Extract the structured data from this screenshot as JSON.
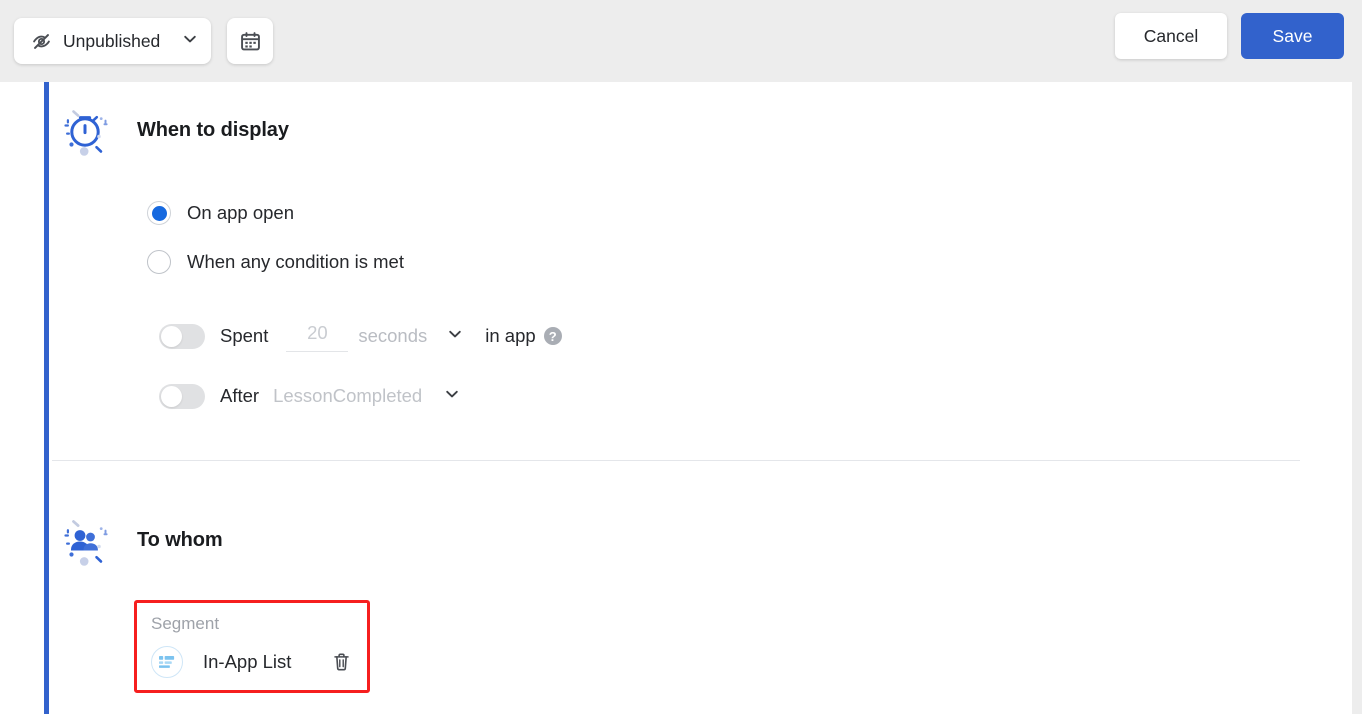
{
  "topbar": {
    "status": {
      "icon": "eye-off-icon",
      "label": "Unpublished",
      "chevron": "chevron-down-icon"
    },
    "schedule_button_icon": "calendar-icon",
    "cancel_label": "Cancel",
    "save_label": "Save",
    "accent_color": "#3262cc",
    "background_color": "#ededed"
  },
  "sections": [
    {
      "id": "when-to-display",
      "icon": "stopwatch-icon",
      "title": "When to display",
      "radios": [
        {
          "label": "On app open",
          "checked": true
        },
        {
          "label": "When any condition is met",
          "checked": false
        }
      ],
      "conditions": [
        {
          "id": "spent-in-app",
          "enabled": false,
          "prefix": "Spent",
          "value_placeholder": "20",
          "value": "",
          "unit": "seconds",
          "unit_chevron": "chevron-down-icon",
          "suffix": "in app",
          "help_icon": "help-circle-icon"
        },
        {
          "id": "after-event",
          "enabled": false,
          "prefix": "After",
          "event": "LessonCompleted",
          "event_chevron": "chevron-down-icon"
        }
      ]
    },
    {
      "id": "to-whom",
      "icon": "people-icon",
      "title": "To whom",
      "segment_card": {
        "label": "Segment",
        "icon": "segment-list-icon",
        "name": "In-App List",
        "delete_icon": "trash-icon",
        "highlight_color": "#f61f1f"
      }
    }
  ]
}
